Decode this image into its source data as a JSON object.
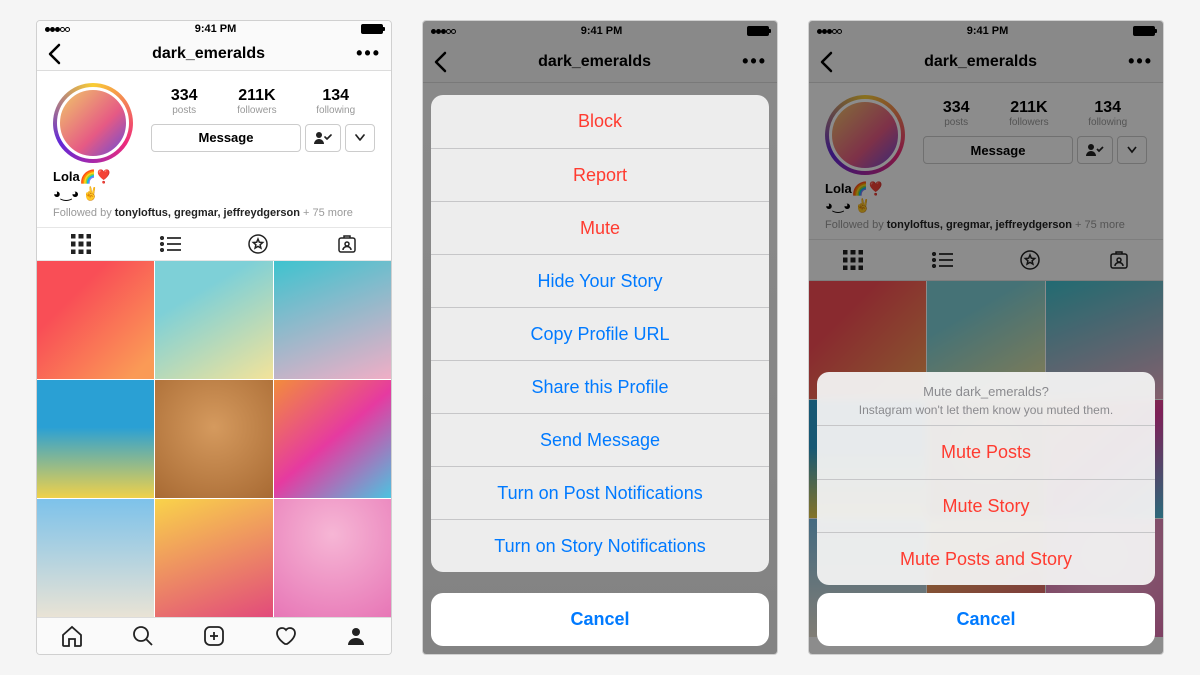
{
  "statusbar": {
    "time": "9:41 PM"
  },
  "navbar": {
    "username": "dark_emeralds"
  },
  "profile": {
    "stats": {
      "posts": {
        "value": "334",
        "label": "posts"
      },
      "followers": {
        "value": "211K",
        "label": "followers"
      },
      "following": {
        "value": "134",
        "label": "following"
      }
    },
    "message_button": "Message",
    "bio": {
      "name": "Lola🌈❣️",
      "line2": "◕‿◕ ✌️"
    },
    "followed_by": {
      "prefix": "Followed by ",
      "names": "tonyloftus, gregmar, jeffreydgerson",
      "suffix": " + 75 more"
    }
  },
  "action_sheet_full": {
    "items": [
      {
        "label": "Block",
        "destructive": true
      },
      {
        "label": "Report",
        "destructive": true
      },
      {
        "label": "Mute",
        "destructive": true
      },
      {
        "label": "Hide Your Story",
        "destructive": false
      },
      {
        "label": "Copy Profile URL",
        "destructive": false
      },
      {
        "label": "Share this Profile",
        "destructive": false
      },
      {
        "label": "Send Message",
        "destructive": false
      },
      {
        "label": "Turn on Post Notifications",
        "destructive": false
      },
      {
        "label": "Turn on Story Notifications",
        "destructive": false
      }
    ],
    "cancel": "Cancel"
  },
  "mute_sheet": {
    "title": "Mute dark_emeralds?",
    "subtitle": "Instagram won't let them know you muted them.",
    "items": [
      {
        "label": "Mute Posts"
      },
      {
        "label": "Mute Story"
      },
      {
        "label": "Mute Posts and Story"
      }
    ],
    "cancel": "Cancel"
  }
}
